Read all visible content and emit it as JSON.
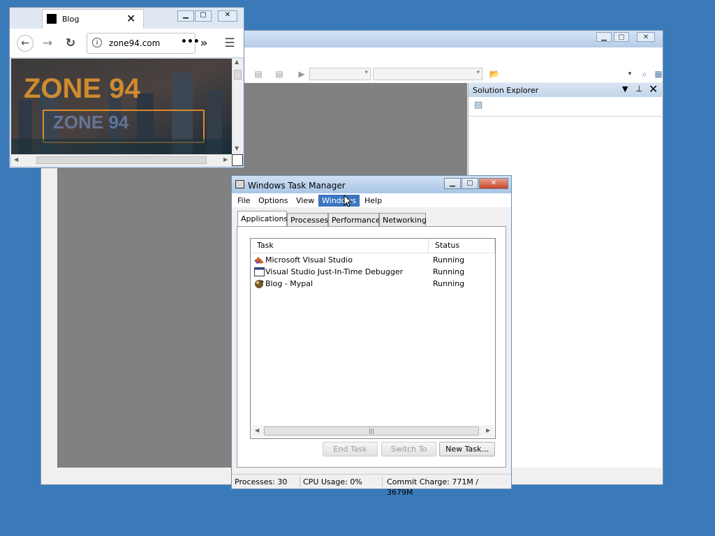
{
  "visual_studio": {
    "solution_explorer_title": "Solution Explorer"
  },
  "browser": {
    "tab_title": "Blog",
    "url": "zone94.com",
    "banner_text": "ZONE 94"
  },
  "task_manager": {
    "title": "Windows Task Manager",
    "menu": [
      "File",
      "Options",
      "View",
      "Windows",
      "Help"
    ],
    "tabs": [
      "Applications",
      "Processes",
      "Performance",
      "Networking"
    ],
    "columns": {
      "task": "Task",
      "status": "Status"
    },
    "rows": [
      {
        "task": "Microsoft Visual Studio",
        "status": "Running",
        "icon": "visual-studio-icon"
      },
      {
        "task": "Visual Studio Just-In-Time Debugger",
        "status": "Running",
        "icon": "debugger-window-icon"
      },
      {
        "task": "Blog - Mypal",
        "status": "Running",
        "icon": "mypal-browser-icon"
      }
    ],
    "buttons": {
      "end_task": "End Task",
      "switch_to": "Switch To",
      "new_task": "New Task..."
    },
    "status": {
      "processes": "Processes: 30",
      "cpu": "CPU Usage: 0%",
      "commit": "Commit Charge: 771M / 3679M"
    }
  },
  "colors": {
    "desktop": "#3a7ab8",
    "menu_highlight": "#3a76c0"
  }
}
